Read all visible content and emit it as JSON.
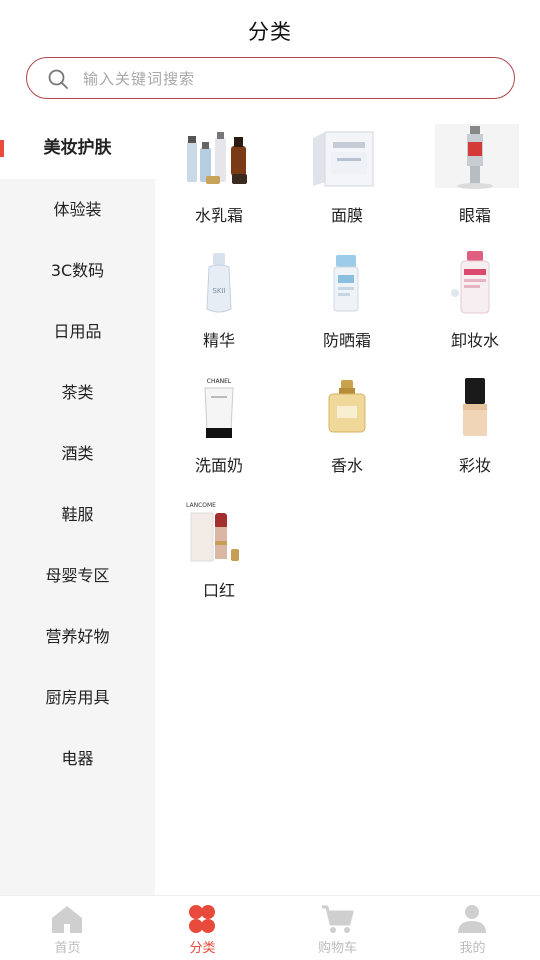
{
  "header": {
    "title": "分类"
  },
  "search": {
    "placeholder": "输入关键词搜索"
  },
  "sidebar": {
    "items": [
      {
        "label": "美妆护肤",
        "active": true
      },
      {
        "label": "体验装"
      },
      {
        "label": "3C数码"
      },
      {
        "label": "日用品"
      },
      {
        "label": "茶类"
      },
      {
        "label": "酒类"
      },
      {
        "label": "鞋服"
      },
      {
        "label": "母婴专区"
      },
      {
        "label": "营养好物"
      },
      {
        "label": "厨房用具"
      },
      {
        "label": "电器"
      }
    ]
  },
  "grid": {
    "items": [
      {
        "label": "水乳霜",
        "icon": "skincare-set-icon"
      },
      {
        "label": "面膜",
        "icon": "face-mask-box-icon"
      },
      {
        "label": "眼霜",
        "icon": "eye-cream-icon"
      },
      {
        "label": "精华",
        "icon": "serum-bottle-icon"
      },
      {
        "label": "防晒霜",
        "icon": "sunscreen-bottle-icon"
      },
      {
        "label": "卸妆水",
        "icon": "micellar-water-icon"
      },
      {
        "label": "洗面奶",
        "icon": "cleanser-tube-icon"
      },
      {
        "label": "香水",
        "icon": "perfume-bottle-icon"
      },
      {
        "label": "彩妆",
        "icon": "foundation-bottle-icon"
      },
      {
        "label": "口红",
        "icon": "lipstick-icon"
      }
    ]
  },
  "product_text": {
    "chanel": "CHANEL",
    "lancome": "LANCOME",
    "sk2": "SKII"
  },
  "tabbar": {
    "items": [
      {
        "label": "首页",
        "icon": "home-icon"
      },
      {
        "label": "分类",
        "icon": "category-icon",
        "active": true
      },
      {
        "label": "购物车",
        "icon": "cart-icon"
      },
      {
        "label": "我的",
        "icon": "user-icon"
      }
    ]
  },
  "colors": {
    "accent": "#e84a3b",
    "search_border": "#b0464b",
    "inactive_tab": "#bcbcbc",
    "sidebar_bg": "#f5f5f5"
  }
}
